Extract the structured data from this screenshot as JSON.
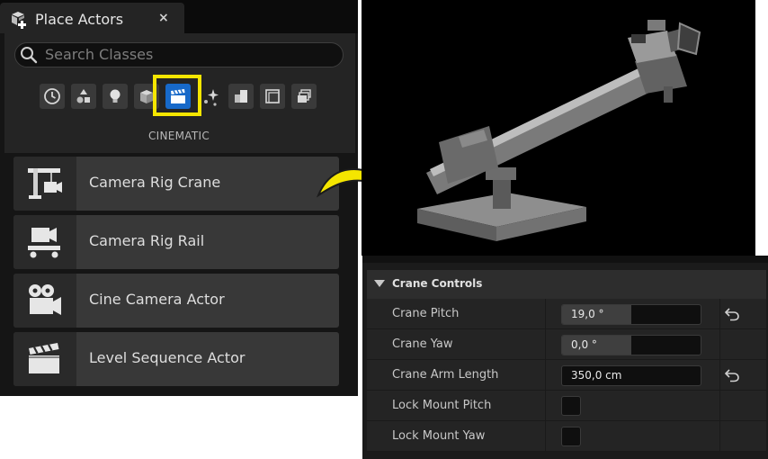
{
  "place_actors": {
    "title": "Place Actors",
    "close_glyph": "×",
    "search_placeholder": "Search Classes",
    "categories": [
      {
        "name": "recent",
        "icon": "clock-icon"
      },
      {
        "name": "basic",
        "icon": "shapes-icon"
      },
      {
        "name": "lights",
        "icon": "lightbulb-icon"
      },
      {
        "name": "shapes",
        "icon": "cube-icon"
      },
      {
        "name": "cinematic",
        "icon": "clapperboard-icon",
        "selected": true
      },
      {
        "name": "visual-effects",
        "icon": "sparkle-icon"
      },
      {
        "name": "geometry",
        "icon": "boxes-icon"
      },
      {
        "name": "volumes",
        "icon": "volume-icon"
      },
      {
        "name": "all-classes",
        "icon": "stack-icon"
      }
    ],
    "active_category_label": "CINEMATIC",
    "actors": [
      {
        "label": "Camera Rig Crane",
        "icon": "crane-icon"
      },
      {
        "label": "Camera Rig Rail",
        "icon": "rail-icon"
      },
      {
        "label": "Cine Camera Actor",
        "icon": "cine-camera-icon"
      },
      {
        "label": "Level Sequence Actor",
        "icon": "clapperboard-icon"
      }
    ]
  },
  "details": {
    "section_title": "Crane Controls",
    "properties": [
      {
        "label": "Crane Pitch",
        "value": "19,0 °",
        "fill_fraction": 0.5,
        "type": "number",
        "resettable": true
      },
      {
        "label": "Crane Yaw",
        "value": "0,0 °",
        "fill_fraction": 0.5,
        "type": "number",
        "resettable": false
      },
      {
        "label": "Crane Arm Length",
        "value": "350,0 cm",
        "fill_fraction": 0,
        "type": "number",
        "resettable": true
      },
      {
        "label": "Lock Mount Pitch",
        "checked": false,
        "type": "checkbox"
      },
      {
        "label": "Lock Mount Yaw",
        "checked": false,
        "type": "checkbox"
      }
    ]
  },
  "colors": {
    "accent_blue": "#1769c9",
    "highlight_yellow": "#f5e600",
    "panel_dark": "#151515",
    "item_bg": "#383838"
  }
}
